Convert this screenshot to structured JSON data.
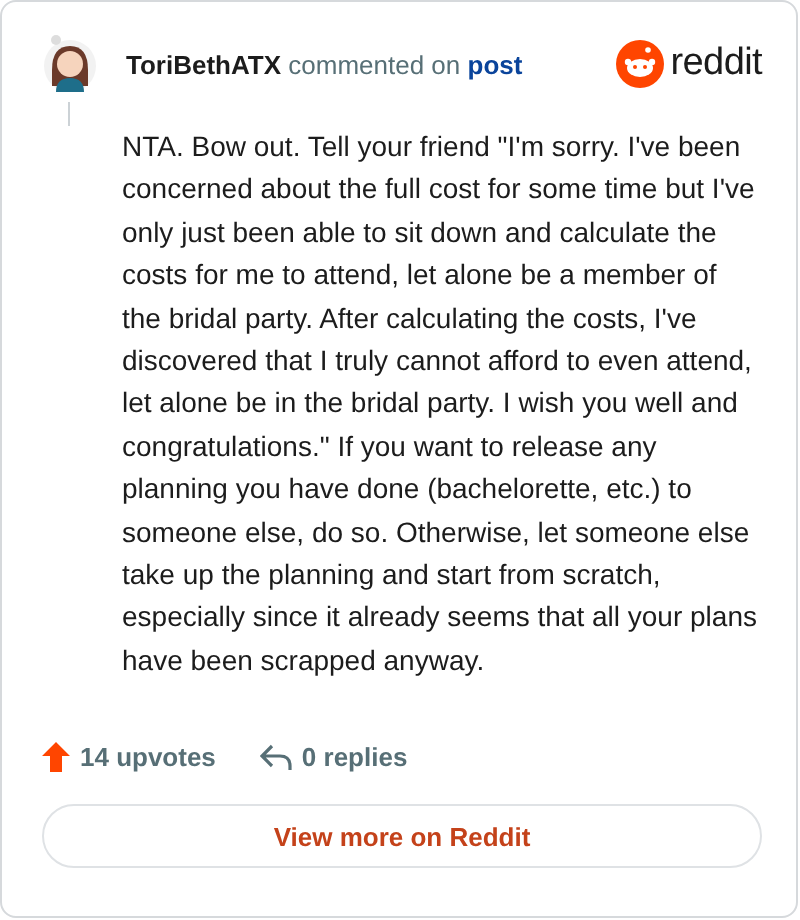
{
  "author": "ToriBethATX",
  "action": "commented on",
  "link": "post",
  "brand": "reddit",
  "body": "NTA. Bow out. Tell your friend \"I'm sorry. I've been concerned about the full cost for some time but I've only just been able to sit down and calculate the costs for me to attend, let alone be a member of the bridal party. After calculating the costs, I've discovered that I truly cannot afford to even attend, let alone be in the bridal party. I wish you well and congratulations.\" If you want to release any planning you have done (bachelorette, etc.) to someone else, do so. Otherwise, let someone else take up the planning and start from scratch, especially since it already seems that all your plans have been scrapped anyway.",
  "upvotes": "14 upvotes",
  "replies": "0 replies",
  "button": "View more on Reddit"
}
